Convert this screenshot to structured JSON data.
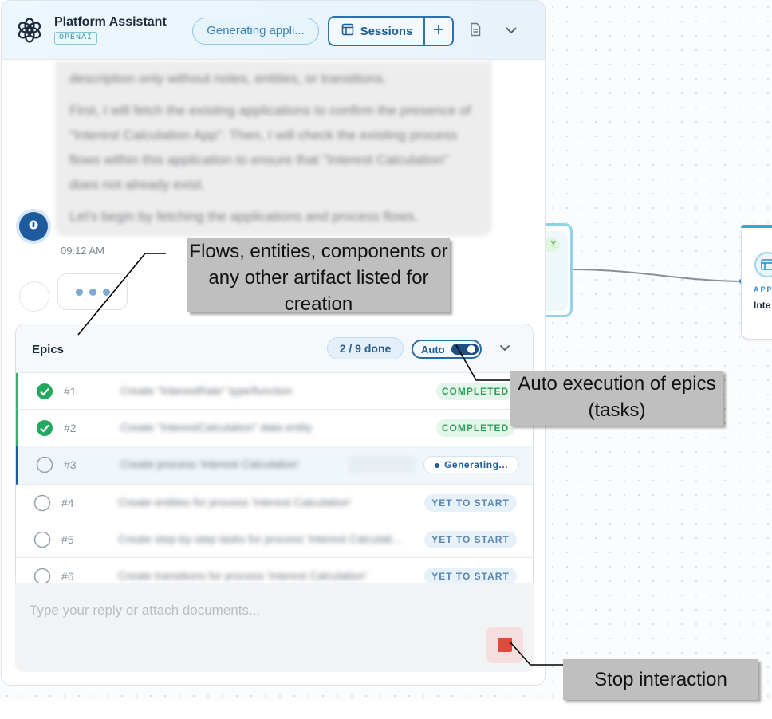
{
  "canvas": {
    "node_a": {
      "badge": "Y"
    },
    "node_b": {
      "type_label": "APP",
      "name": "Inte"
    }
  },
  "header": {
    "title": "Platform Assistant",
    "provider_badge": "OPENAI",
    "status_pill": "Generating appli...",
    "sessions_label": "Sessions",
    "icons": [
      "openai-logo",
      "table-icon",
      "plus-icon",
      "document-icon",
      "chevron-down-icon"
    ]
  },
  "message": {
    "paragraphs": [
      "description only without notes, entities, or transitions.",
      "First, I will fetch the existing applications to confirm the presence of \"Interest Calculation App\". Then, I will check the existing process flows within this application to ensure that \"Interest Calculation\" does not already exist.",
      "Let's begin by fetching the applications and process flows."
    ],
    "time": "09:12 AM"
  },
  "epics": {
    "title": "Epics",
    "progress": "2 / 9 done",
    "auto_label": "Auto",
    "auto_enabled": true,
    "items": [
      {
        "num": "#1",
        "title": "Create \"InterestRate\" type/function",
        "status": "COMPLETED",
        "state": "done"
      },
      {
        "num": "#2",
        "title": "Create \"InterestCalculation\" data entity",
        "status": "COMPLETED",
        "state": "done"
      },
      {
        "num": "#3",
        "title": "Create process 'Interest Calculation'",
        "status": "Generating...",
        "state": "active"
      },
      {
        "num": "#4",
        "title": "Create entities for process 'Interest Calculation'",
        "status": "YET TO START",
        "state": "pending"
      },
      {
        "num": "#5",
        "title": "Create step-by-step tasks for process 'Interest Calculation'",
        "status": "YET TO START",
        "state": "pending"
      },
      {
        "num": "#6",
        "title": "Create transitions for process 'Interest Calculation'",
        "status": "YET TO START",
        "state": "pending"
      }
    ]
  },
  "composer": {
    "placeholder": "Type your reply or attach documents..."
  },
  "callouts": {
    "artifacts": "Flows, entities, components or any other artifact listed for creation",
    "auto": "Auto execution of epics (tasks)",
    "stop": "Stop interaction"
  },
  "colors": {
    "accent": "#1e5aa0",
    "completed": "#2db36b",
    "stop": "#e04a3a",
    "callout_bg": "#bfbfbf"
  }
}
